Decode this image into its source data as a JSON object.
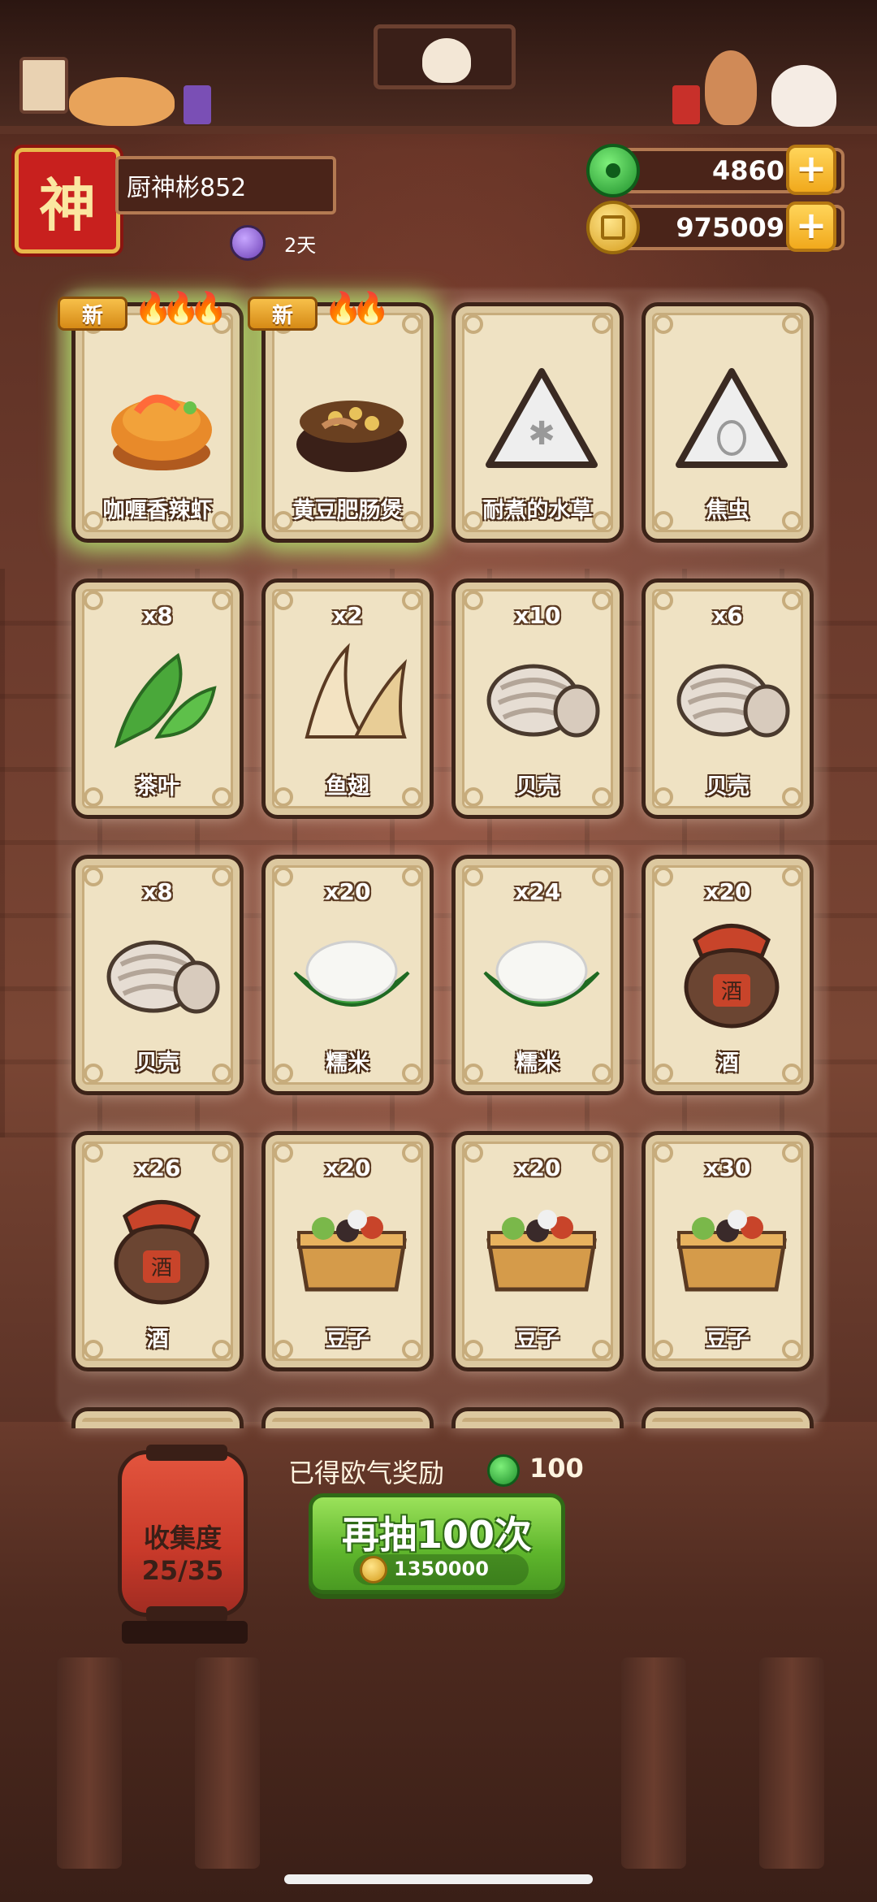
{
  "player": {
    "avatar_glyph": "神",
    "name": "厨神彬852",
    "buff_days": "2天"
  },
  "currency": {
    "jade": "4860",
    "coins": "975009",
    "add_symbol": "+"
  },
  "cards": [
    {
      "label": "咖喱香辣虾",
      "count": "",
      "new": true,
      "new_text": "新",
      "icon": "curry-shrimp-icon",
      "flames": 3
    },
    {
      "label": "黄豆肥肠煲",
      "count": "",
      "new": true,
      "new_text": "新",
      "icon": "soybean-intestine-pot-icon",
      "flames": 2
    },
    {
      "label": "耐煮的水草",
      "count": "",
      "new": false,
      "icon": "locked-waterweed-icon"
    },
    {
      "label": "焦虫",
      "count": "",
      "new": false,
      "icon": "locked-bug-icon"
    },
    {
      "label": "茶叶",
      "count": "x8",
      "new": false,
      "icon": "tea-leaf-icon"
    },
    {
      "label": "鱼翅",
      "count": "x2",
      "new": false,
      "icon": "shark-fin-icon"
    },
    {
      "label": "贝壳",
      "count": "x10",
      "new": false,
      "icon": "clam-icon"
    },
    {
      "label": "贝壳",
      "count": "x6",
      "new": false,
      "icon": "clam-icon"
    },
    {
      "label": "贝壳",
      "count": "x8",
      "new": false,
      "icon": "clam-icon"
    },
    {
      "label": "糯米",
      "count": "x20",
      "new": false,
      "icon": "rice-icon"
    },
    {
      "label": "糯米",
      "count": "x24",
      "new": false,
      "icon": "rice-icon"
    },
    {
      "label": "酒",
      "count": "x20",
      "new": false,
      "icon": "wine-jar-icon"
    },
    {
      "label": "酒",
      "count": "x26",
      "new": false,
      "icon": "wine-jar-icon"
    },
    {
      "label": "豆子",
      "count": "x20",
      "new": false,
      "icon": "bean-box-icon"
    },
    {
      "label": "豆子",
      "count": "x20",
      "new": false,
      "icon": "bean-box-icon"
    },
    {
      "label": "豆子",
      "count": "x30",
      "new": false,
      "icon": "bean-box-icon"
    }
  ],
  "collection": {
    "title": "收集度",
    "value": "25/35"
  },
  "reward": {
    "label": "已得欧气奖励",
    "value": "100"
  },
  "draw_button": {
    "label": "再抽100次",
    "cost": "1350000"
  },
  "colors": {
    "accent_green": "#5eb52c",
    "gold": "#f1a91c",
    "card_bg": "#efe2c3",
    "dark_wood": "#3a1f17"
  }
}
